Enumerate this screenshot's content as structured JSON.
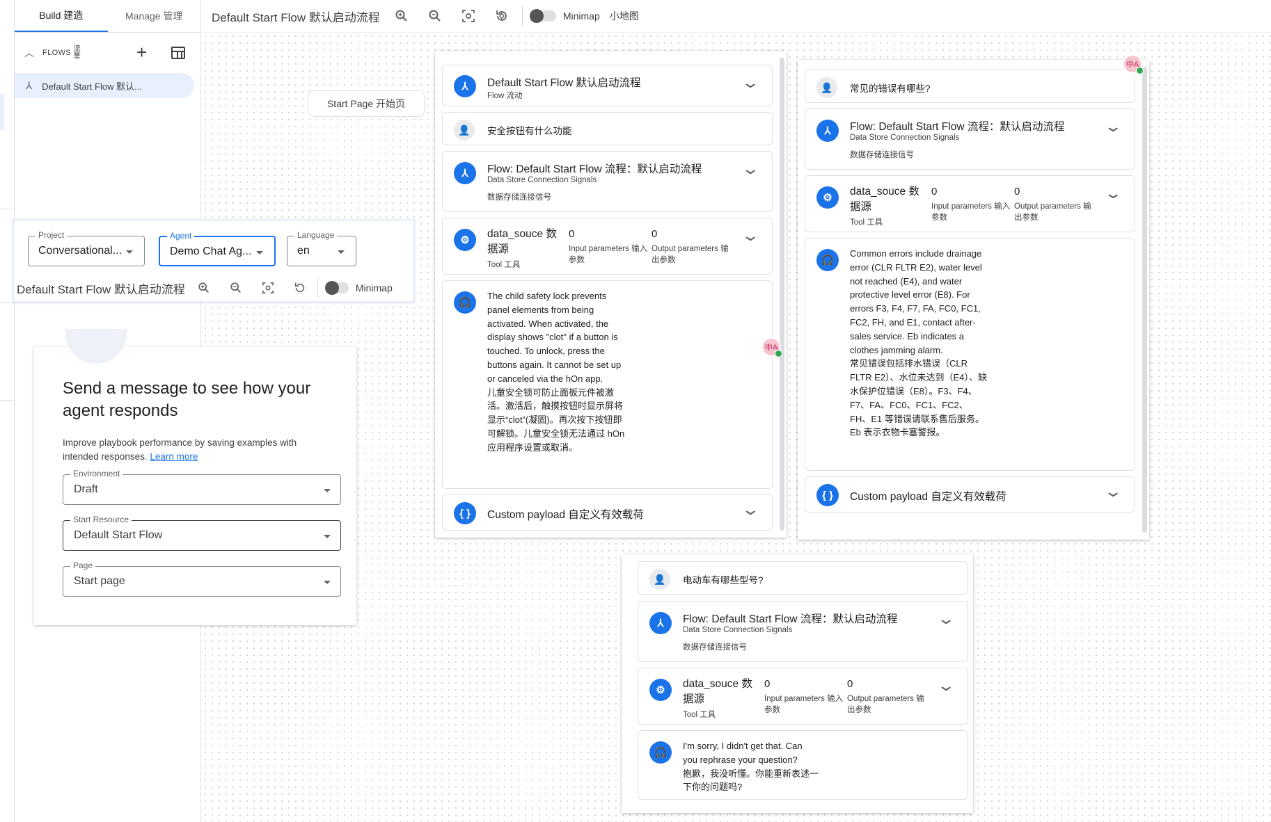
{
  "sidebar": {
    "tabs": [
      {
        "label": "Build 建造"
      },
      {
        "label": "Manage 管理"
      }
    ],
    "flows_label": "FLOWS",
    "flows_label_zh": "流量",
    "flow_items": [
      {
        "label": "Default Start Flow 默认..."
      }
    ]
  },
  "toolbar": {
    "title": "Default Start Flow 默认启动流程",
    "minimap_label": "Minimap",
    "minimap_label_zh": "小地图"
  },
  "canvas": {
    "start_page_label": "Start Page 开始页"
  },
  "agent_bar": {
    "project": {
      "label": "Project",
      "value": "Conversational..."
    },
    "agent": {
      "label": "Agent",
      "value": "Demo Chat Ag..."
    },
    "language": {
      "label": "Language",
      "value": "en"
    },
    "flow_title": "Default Start Flow 默认启动流程",
    "minimap_label": "Minimap"
  },
  "simulator": {
    "heading": "Send a message to see how your agent responds",
    "description": "Improve playbook performance by saving examples with intended responses.",
    "learn_more": "Learn more",
    "environment": {
      "label": "Environment",
      "value": "Draft"
    },
    "start_resource": {
      "label": "Start Resource",
      "value": "Default Start Flow"
    },
    "page": {
      "label": "Page",
      "value": "Start page"
    }
  },
  "conversations": [
    {
      "flow_card": {
        "title": "Default Start Flow 默认启动流程",
        "subtitle": "Flow 流动"
      },
      "user_message": "安全按钮有什么功能",
      "flow_signal": {
        "title": "Flow: Default Start Flow 流程：默认启动流程",
        "line1": "Data Store Connection Signals",
        "line2": "数据存储连接信号"
      },
      "data_store": {
        "name": "data_souce 数据源",
        "tool": "Tool 工具",
        "input_count": "0",
        "input_label": "Input parameters 输入参数",
        "output_count": "0",
        "output_label": "Output parameters 输出参数"
      },
      "agent_reply": "The child safety lock prevents panel elements from being activated. When activated, the display shows \"clot\" if a button is touched. To unlock, press the buttons again. It cannot be set up or canceled via the hOn app.\n儿童安全锁可防止面板元件被激活。激活后，触摸按钮时显示屏将显示“clot”(凝固)。再次按下按钮即可解锁。儿童安全锁无法通过 hOn 应用程序设置或取消。",
      "custom_payload": "Custom payload 自定义有效载荷"
    },
    {
      "user_message": "常见的错误有哪些?",
      "flow_signal": {
        "title": "Flow: Default Start Flow 流程：默认启动流程",
        "line1": "Data Store Connection Signals",
        "line2": "数据存储连接信号"
      },
      "data_store": {
        "name": "data_souce 数据源",
        "tool": "Tool 工具",
        "input_count": "0",
        "input_label": "Input parameters 输入参数",
        "output_count": "0",
        "output_label": "Output parameters 输出参数"
      },
      "agent_reply": "Common errors include drainage error (CLR FLTR E2), water level not reached (E4), and water protective level error (E8). For errors F3, F4, F7, FA, FC0, FC1, FC2, FH, and E1, contact after-sales service. Eb indicates a clothes jamming alarm.\n常见错误包括排水错误（CLR FLTR E2）、水位未达到（E4）、缺水保护位错误（E8）。F3、F4、F7、FA、FC0、FC1、FC2、FH、E1 等错误请联系售后服务。Eb 表示衣物卡塞警报。",
      "custom_payload": "Custom payload 自定义有效载荷"
    },
    {
      "user_message": "电动车有哪些型号?",
      "flow_signal": {
        "title": "Flow: Default Start Flow 流程：默认启动流程",
        "line1": "Data Store Connection Signals",
        "line2": "数据存储连接信号"
      },
      "data_store": {
        "name": "data_souce 数据源",
        "tool": "Tool 工具",
        "input_count": "0",
        "input_label": "Input parameters 输入参数",
        "output_count": "0",
        "output_label": "Output parameters 输出参数"
      },
      "agent_reply": "I'm sorry, I didn't get that. Can you rephrase your question?\n抱歉，我没听懂。你能重新表述一下你的问题吗?"
    }
  ],
  "avatar_text": "中A",
  "colors": {
    "accent": "#1a73e8",
    "selected_bg": "#e8f0fe",
    "border": "#e0e0e0"
  }
}
